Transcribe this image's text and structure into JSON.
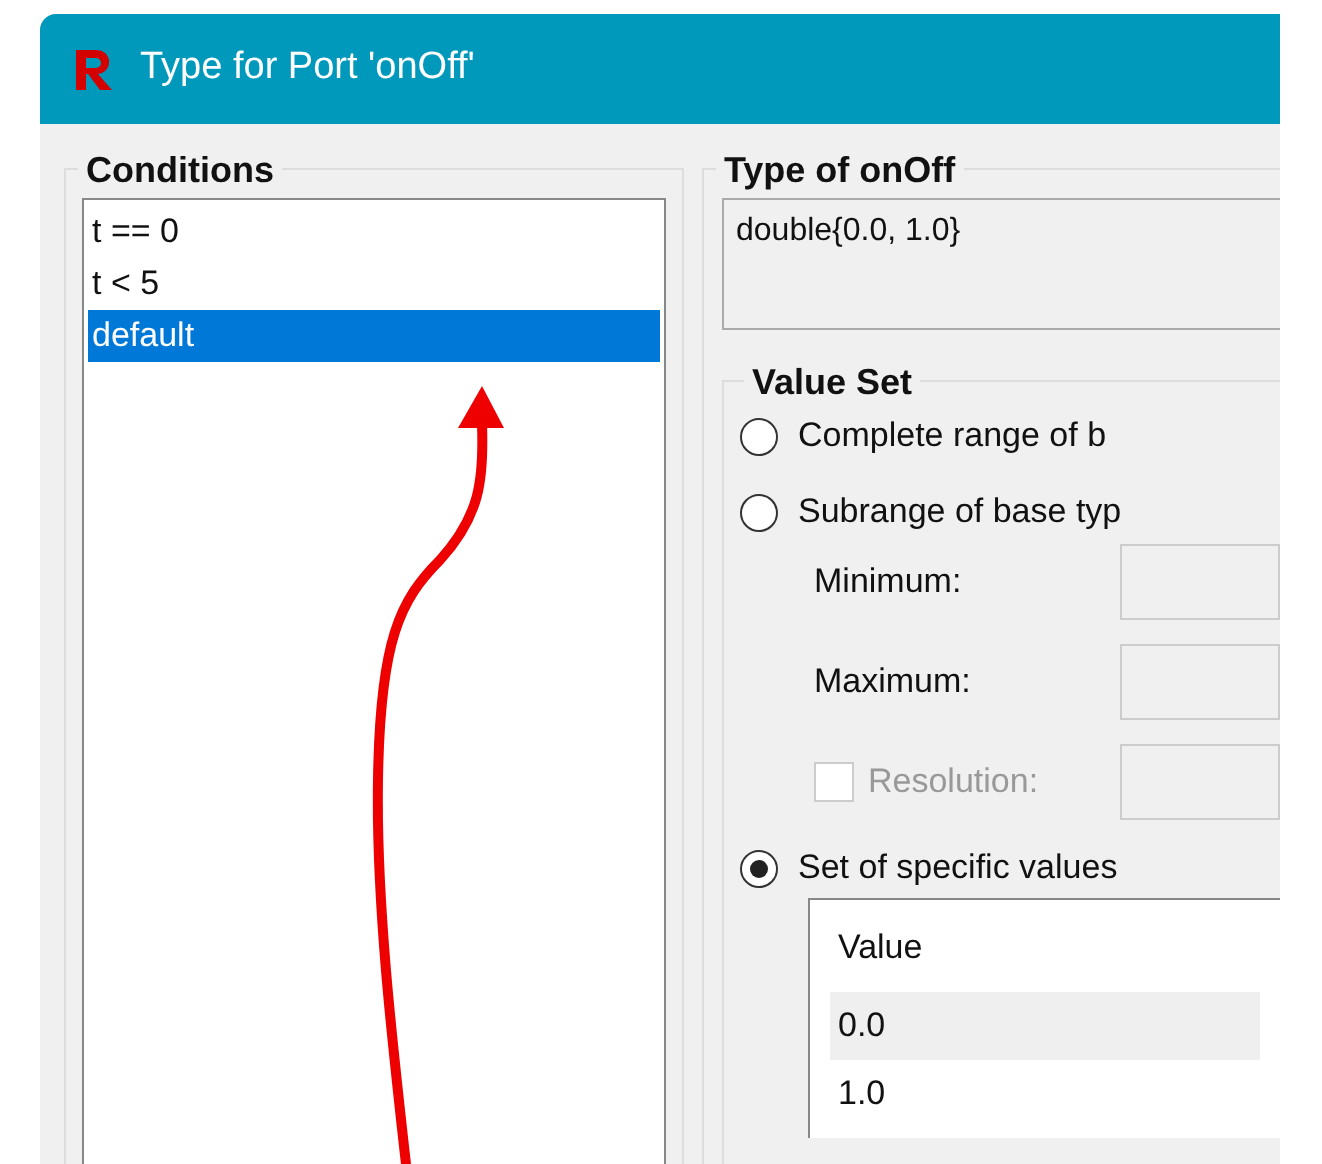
{
  "window": {
    "title": "Type for Port 'onOff'"
  },
  "conditions": {
    "label": "Conditions",
    "items": [
      {
        "text": "t == 0",
        "selected": false
      },
      {
        "text": "t < 5",
        "selected": false
      },
      {
        "text": "default",
        "selected": true
      }
    ]
  },
  "type": {
    "label": "Type of onOff",
    "value": "double{0.0, 1.0}"
  },
  "value_set": {
    "label": "Value Set",
    "options": [
      {
        "label": "Complete range of b",
        "selected": false
      },
      {
        "label": "Subrange of base typ",
        "selected": false
      },
      {
        "label": "Set of specific values",
        "selected": true
      }
    ],
    "minimum": {
      "label": "Minimum:"
    },
    "maximum": {
      "label": "Maximum:"
    },
    "resolution": {
      "label": "Resolution:",
      "checked": false,
      "disabled": true
    },
    "table": {
      "columns": [
        "Value"
      ],
      "rows": [
        {
          "value": "0.0",
          "selected": true
        },
        {
          "value": "1.0",
          "selected": false
        }
      ]
    }
  }
}
